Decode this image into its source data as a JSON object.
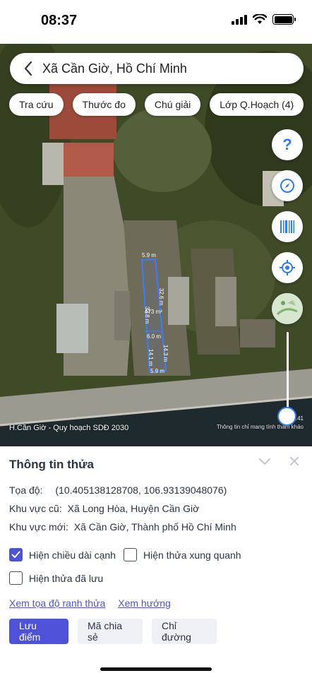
{
  "status": {
    "time": "08:37"
  },
  "search": {
    "text": "Xã Cần Giờ, Hồ Chí Minh"
  },
  "chips": [
    "Tra cứu",
    "Thước đo",
    "Chú giải",
    "Lớp Q.Hoạch (4)"
  ],
  "map": {
    "caption": "H.Cần Giờ - Quy hoạch SDĐ 2030",
    "attribution": "Thông tin chỉ mang tính tham khảo",
    "attribution_top": "Phá...41",
    "parcel": {
      "top_edge": "5.9 m",
      "bottom_edge": "5.9 m",
      "area": "473 m²",
      "mid_width": "6.0 m",
      "left_upper": "32.8 m",
      "right_upper": "32.6 m",
      "left_lower": "14.1 m",
      "right_lower": "14.3 m"
    }
  },
  "panel": {
    "title": "Thông tin thửa",
    "coords_label": "Tọa độ:",
    "coords_value": "(10.405138128708, 106.93139048076)",
    "old_area_label": "Khu vực cũ:",
    "old_area_value": "Xã Long Hòa, Huyện Cần Giờ",
    "new_area_label": "Khu vực mới:",
    "new_area_value": "Xã Cần Giờ, Thành phố Hồ Chí Minh",
    "checks": {
      "edge_length": {
        "label": "Hiện chiều dài cạnh",
        "checked": true
      },
      "surrounding": {
        "label": "Hiện thửa xung quanh",
        "checked": false
      },
      "saved": {
        "label": "Hiện thửa đã lưu",
        "checked": false
      }
    },
    "link_coords": "Xem tọa độ ranh thửa",
    "link_direction": "Xem hướng",
    "btn_save": "Lưu điểm",
    "btn_share": "Mã chia sẻ",
    "btn_route": "Chỉ đường"
  },
  "colors": {
    "accent": "#4d52d8",
    "parcel_outline": "#3b7bff"
  }
}
